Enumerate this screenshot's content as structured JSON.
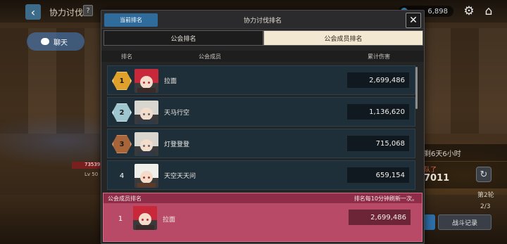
{
  "background": {
    "top_title": "协力讨伐",
    "help_label": "?",
    "currency_value": "6,898",
    "chat_label": "聊天",
    "hp_text": "73539",
    "level_text": "Lv 50",
    "remaining_time": "剩6天6小时",
    "info_small": "队了",
    "info_big": "7011",
    "round_label": "第2轮",
    "round_count": "2/3",
    "battle_log_label": "战斗记录"
  },
  "modal": {
    "current_rank_tag": "当前排名",
    "title": "协力讨伐排名",
    "close_symbol": "✕",
    "tabs": [
      {
        "label": "公会排名",
        "active": false
      },
      {
        "label": "公会成员排名",
        "active": true
      }
    ],
    "columns": {
      "rank": "排名",
      "member": "公会成员",
      "damage": "累计伤害"
    },
    "rows": [
      {
        "rank": "1",
        "name": "拉面",
        "damage": "2,699,486",
        "badge": "gold",
        "avatar": "red-hair"
      },
      {
        "rank": "2",
        "name": "天马行空",
        "damage": "1,136,620",
        "badge": "silver",
        "avatar": "silver-hair"
      },
      {
        "rank": "3",
        "name": "灯登登登",
        "damage": "715,068",
        "badge": "bronze",
        "avatar": "silver-hair"
      },
      {
        "rank": "4",
        "name": "天空天天问",
        "damage": "659,154",
        "badge": "none",
        "avatar": "white-hair"
      }
    ],
    "my_rank": {
      "header_left": "公会成员排名",
      "header_right": "排名每10分钟刷新一次。",
      "rank": "1",
      "name": "拉面",
      "damage": "2,699,486"
    }
  },
  "colors": {
    "gold": "#e0a12c",
    "silver": "#9ec6cf",
    "bronze": "#a8653a",
    "accent_blue": "#2f6c9b",
    "my_rank_bg": "#b94a67"
  },
  "icons": {
    "back": "back-arrow-icon",
    "settings": "gear-icon",
    "home": "home-icon",
    "close": "close-icon",
    "refresh": "refresh-icon"
  }
}
